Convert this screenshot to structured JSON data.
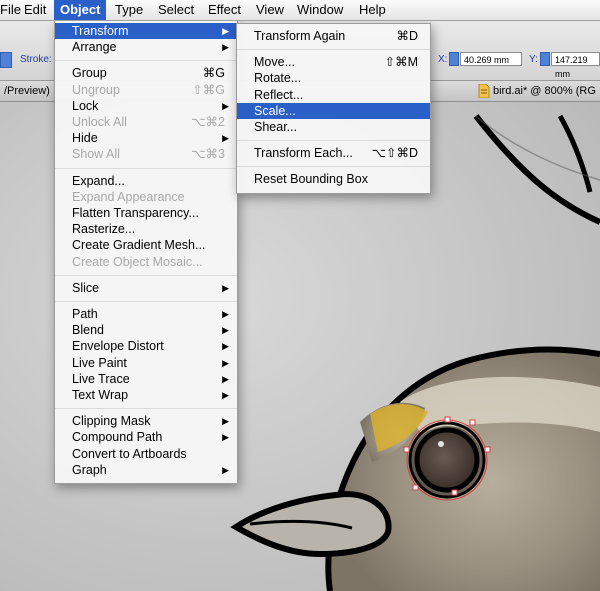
{
  "menubar": {
    "items": [
      {
        "label": "File"
      },
      {
        "label": "Edit"
      },
      {
        "label": "Object",
        "active": true
      },
      {
        "label": "Type"
      },
      {
        "label": "Select"
      },
      {
        "label": "Effect"
      },
      {
        "label": "View"
      },
      {
        "label": "Window"
      },
      {
        "label": "Help"
      }
    ]
  },
  "controlbar": {
    "stroke_label": "Stroke:",
    "x_label": "X:",
    "x_value": "40.269 mm",
    "y_label": "Y:",
    "y_value": "147.219 mm"
  },
  "tabs": {
    "left_tab": "/Preview)",
    "doc_tab": "bird.ai* @ 800% (RG"
  },
  "object_menu": [
    {
      "label": "Transform",
      "submenu": true,
      "highlighted": true
    },
    {
      "label": "Arrange",
      "submenu": true
    },
    {
      "sep": true
    },
    {
      "label": "Group",
      "shortcut": "⌘G"
    },
    {
      "label": "Ungroup",
      "shortcut": "⇧⌘G",
      "disabled": true
    },
    {
      "label": "Lock",
      "submenu": true
    },
    {
      "label": "Unlock All",
      "shortcut": "⌥⌘2",
      "disabled": true
    },
    {
      "label": "Hide",
      "submenu": true
    },
    {
      "label": "Show All",
      "shortcut": "⌥⌘3",
      "disabled": true
    },
    {
      "sep": true
    },
    {
      "label": "Expand..."
    },
    {
      "label": "Expand Appearance",
      "disabled": true
    },
    {
      "label": "Flatten Transparency..."
    },
    {
      "label": "Rasterize..."
    },
    {
      "label": "Create Gradient Mesh..."
    },
    {
      "label": "Create Object Mosaic...",
      "disabled": true
    },
    {
      "sep": true
    },
    {
      "label": "Slice",
      "submenu": true
    },
    {
      "sep": true
    },
    {
      "label": "Path",
      "submenu": true
    },
    {
      "label": "Blend",
      "submenu": true
    },
    {
      "label": "Envelope Distort",
      "submenu": true
    },
    {
      "label": "Live Paint",
      "submenu": true
    },
    {
      "label": "Live Trace",
      "submenu": true
    },
    {
      "label": "Text Wrap",
      "submenu": true
    },
    {
      "sep": true
    },
    {
      "label": "Clipping Mask",
      "submenu": true
    },
    {
      "label": "Compound Path",
      "submenu": true
    },
    {
      "label": "Convert to Artboards"
    },
    {
      "label": "Graph",
      "submenu": true
    }
  ],
  "transform_menu": [
    {
      "label": "Transform Again",
      "shortcut": "⌘D"
    },
    {
      "sep": true
    },
    {
      "label": "Move...",
      "shortcut": "⇧⌘M"
    },
    {
      "label": "Rotate..."
    },
    {
      "label": "Reflect..."
    },
    {
      "label": "Scale...",
      "highlighted": true
    },
    {
      "label": "Shear..."
    },
    {
      "sep": true
    },
    {
      "label": "Transform Each...",
      "shortcut": "⌥⇧⌘D"
    },
    {
      "sep": true
    },
    {
      "label": "Reset Bounding Box"
    }
  ],
  "colors": {
    "menu_highlight": "#2a5fc8",
    "outline": "#000000",
    "eye_yellow": "#d8b030",
    "selection": "#d04040"
  },
  "icons": [
    "submenu-arrow-icon",
    "document-icon",
    "spinner-icon"
  ]
}
